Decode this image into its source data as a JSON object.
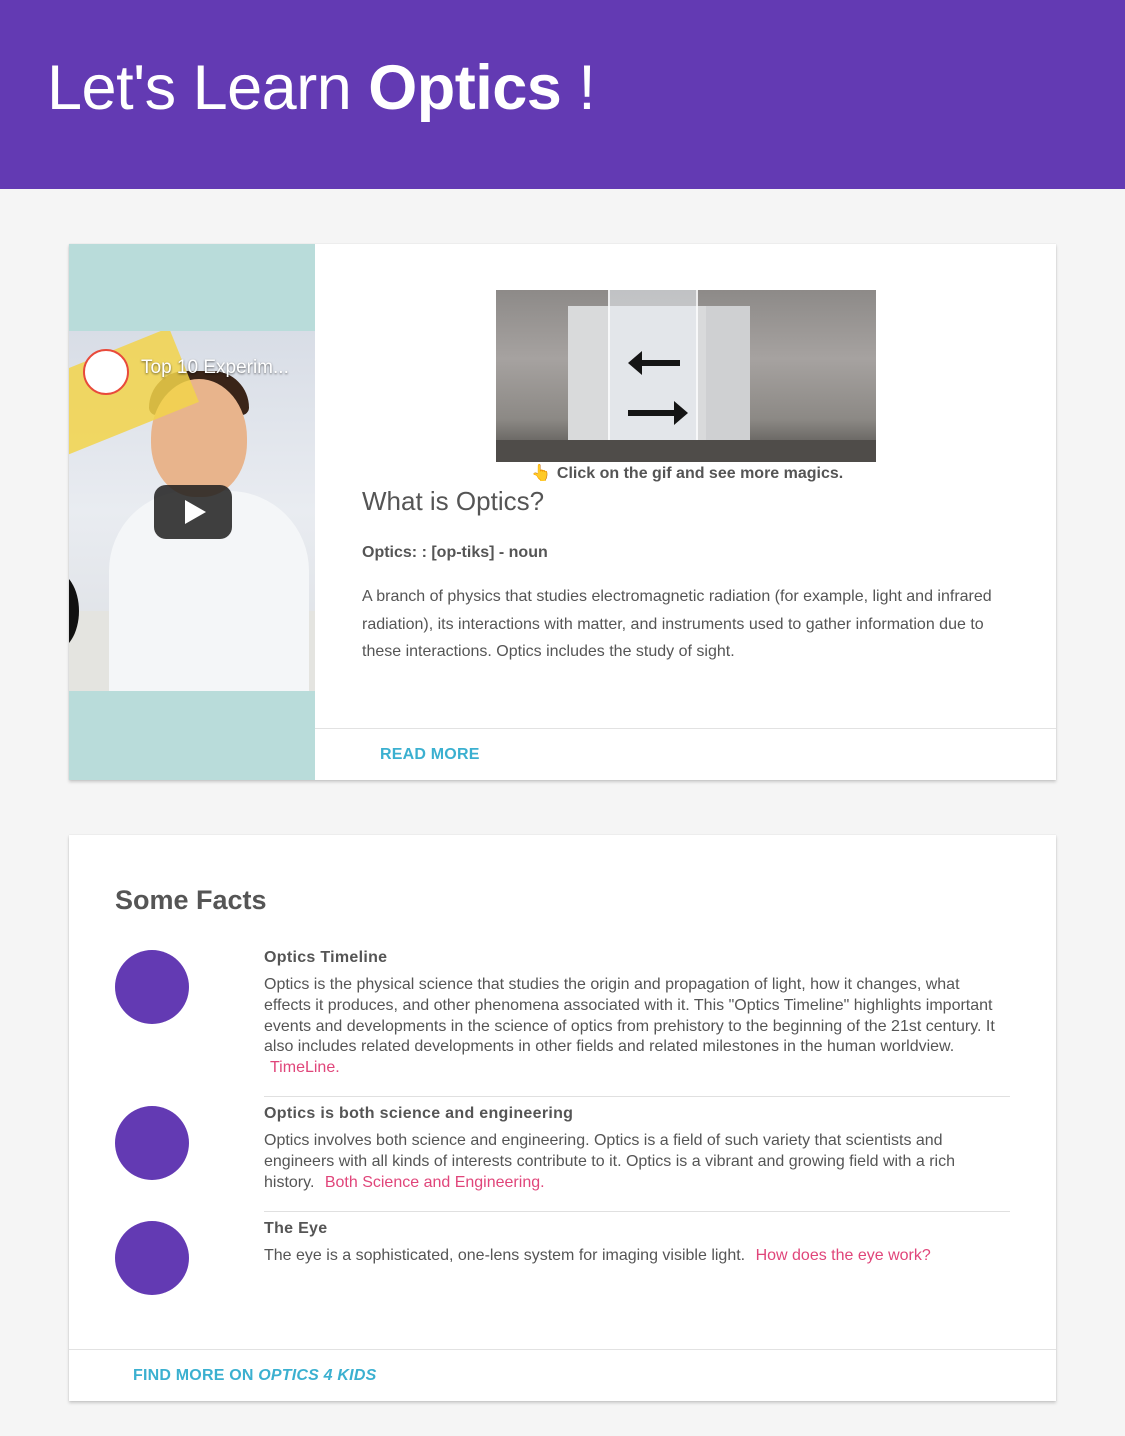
{
  "header": {
    "title_prefix": "Let's Learn ",
    "title_bold": "Optics",
    "title_suffix": " !"
  },
  "intro_card": {
    "video": {
      "title": "Top 10 Experim...",
      "play_icon": "play-icon"
    },
    "gif_hint_icon": "pointing-hand-icon",
    "gif_hint": "Click on the gif and see more magics.",
    "heading": "What is Optics?",
    "term": "Optics: : [op-tiks] - noun",
    "definition": "A branch of physics that studies electromagnetic radiation (for example, light and infrared radiation), its interactions with matter, and instruments used to gather information due to these interactions. Optics includes the study of sight.",
    "read_more": "Read more"
  },
  "facts_card": {
    "title": "Some Facts",
    "items": [
      {
        "title": "Optics Timeline",
        "body": "Optics is the physical science that studies the origin and propagation of light, how it changes, what effects it produces, and other phenomena associated with it. This \"Optics Timeline\" highlights important events and developments in the science of optics from prehistory to the beginning of the 21st century. It also includes related developments in other fields and related milestones in the human worldview.",
        "link": "TimeLine."
      },
      {
        "title": "Optics is both science and engineering",
        "body": "Optics involves both science and engineering. Optics is a field of such variety that scientists and engineers with all kinds of interests contribute to it. Optics is a vibrant and growing field with a rich history.",
        "link": "Both Science and Engineering."
      },
      {
        "title": "The Eye",
        "body": "The eye is a sophisticated, one-lens system for imaging visible light.",
        "link": "How does the eye work?"
      }
    ],
    "find_more_prefix": "Find more on ",
    "find_more_link": "Optics 4 kids"
  },
  "colors": {
    "primary": "#633ab3",
    "accent_link": "#e0457a",
    "action_text": "#3bb0d0",
    "video_panel": "#b9dcda"
  }
}
